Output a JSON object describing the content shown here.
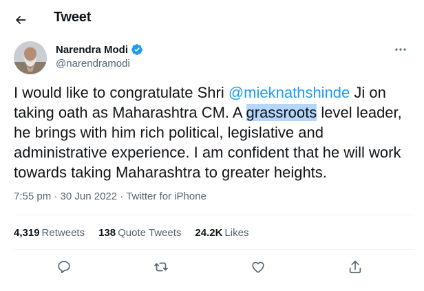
{
  "header": {
    "title": "Tweet"
  },
  "author": {
    "name": "Narendra Modi",
    "handle": "@narendramodi",
    "verified": true
  },
  "tweet": {
    "text_before_mention": "I would like to congratulate Shri ",
    "mention": "@mieknathshinde",
    "text_after_mention": " Ji on taking oath as Maharashtra CM. A ",
    "highlighted": "grassroots",
    "text_after_highlight": " level leader, he brings with him rich political, legislative and administrative experience. I am confident that he will work towards taking Maharashtra to greater heights."
  },
  "meta": {
    "time": "7:55 pm",
    "separator": " · ",
    "date": "30 Jun 2022",
    "source": "Twitter for iPhone"
  },
  "stats": {
    "retweets_count": "4,319",
    "retweets_label": "Retweets",
    "quote_count": "138",
    "quote_label": "Quote Tweets",
    "likes_count": "24.2K",
    "likes_label": "Likes"
  },
  "actions": [
    "reply-icon",
    "retweet-icon",
    "like-icon",
    "share-icon"
  ],
  "colors": {
    "accent": "#1d9bf0",
    "text": "#0f1419",
    "muted": "#536471",
    "divider": "#eff3f4",
    "highlight": "#b6d7fb"
  }
}
